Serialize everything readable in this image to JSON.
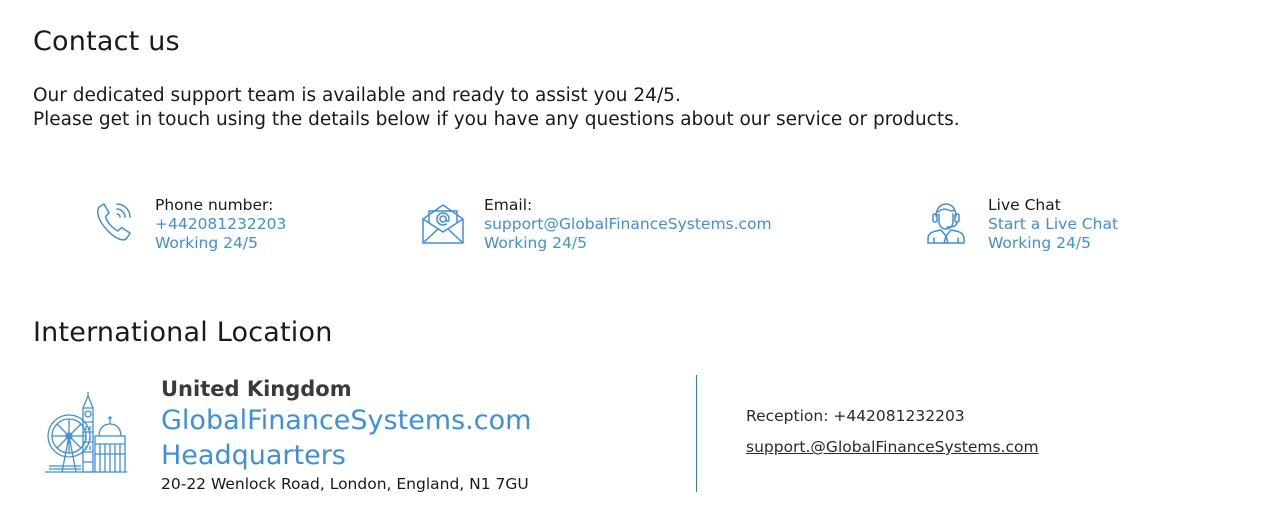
{
  "contact": {
    "title": "Contact us",
    "intro_line1": "Our dedicated support team is available and ready to assist you 24/5.",
    "intro_line2": "Please get in touch using the details below if you have any questions about our service or products."
  },
  "methods": {
    "phone": {
      "icon": "phone-icon",
      "label": "Phone number:",
      "value": "+442081232203",
      "hours": "Working 24/5"
    },
    "email": {
      "icon": "envelope-icon",
      "label": "Email:",
      "value": "support@GlobalFinanceSystems.com",
      "hours": "Working 24/5"
    },
    "chat": {
      "icon": "support-agent-icon",
      "label": "Live Chat",
      "value": "Start a Live Chat",
      "hours": "Working 24/5"
    }
  },
  "location": {
    "title": "International Location",
    "icon": "london-landmarks-icon",
    "country": "United Kingdom",
    "office_line1": "GlobalFinanceSystems.com",
    "office_line2": "Headquarters",
    "address": "20-22 Wenlock Road, London, England, N1 7GU",
    "reception": "Reception: +442081232203",
    "email": "support.@GlobalFinanceSystems.com"
  },
  "colors": {
    "accent": "#3f8fd9",
    "text": "#1a1a1a",
    "divider": "#2f7fc4"
  }
}
